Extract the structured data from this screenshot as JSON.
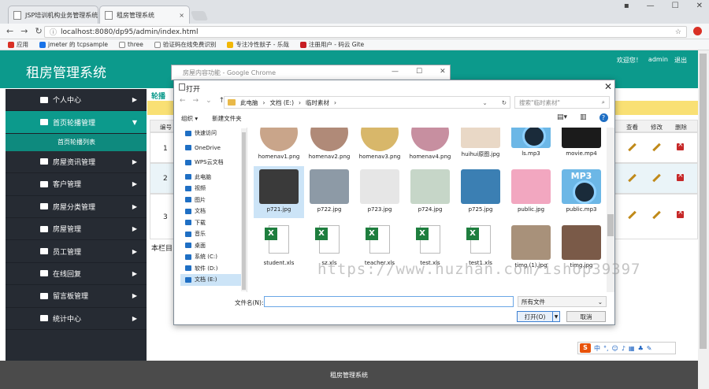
{
  "browser": {
    "tabs": [
      {
        "label": "JSP培训机构业务管理系统"
      },
      {
        "label": "租房管理系统"
      }
    ],
    "url": "localhost:8080/dp95/admin/index.html",
    "bookmarks": [
      {
        "label": "应用",
        "color": "#d93025"
      },
      {
        "label": "jmeter 的 tcpsample",
        "color": "#1a73e8"
      },
      {
        "label": "three",
        "color": "#555555"
      },
      {
        "label": "验证码在线免费识别",
        "color": "#5f6368"
      },
      {
        "label": "专注冷性獃子 - 乐哉",
        "color": "#f2b705"
      },
      {
        "label": "注册用户 - 码云 Gite",
        "color": "#c71d23"
      }
    ]
  },
  "app": {
    "title": "租房管理系统",
    "welcome": "欢迎您！",
    "user": "admin",
    "logout": "退出",
    "footer": "租房管理系统",
    "sidebar": [
      {
        "label": "个人中心",
        "arrow": "▶"
      },
      {
        "label": "首页轮播管理",
        "arrow": "▼",
        "active": true
      },
      {
        "label": "房屋资讯管理",
        "arrow": "▶"
      },
      {
        "label": "客户管理",
        "arrow": "▶"
      },
      {
        "label": "房屋分类管理",
        "arrow": "▶"
      },
      {
        "label": "房屋管理",
        "arrow": "▶"
      },
      {
        "label": "员工管理",
        "arrow": "▶"
      },
      {
        "label": "在线回复",
        "arrow": "▶"
      },
      {
        "label": "留言板管理",
        "arrow": "▶"
      },
      {
        "label": "统计中心",
        "arrow": "▶"
      }
    ],
    "sub_item": "首页轮播列表",
    "table_tab": "轮播",
    "table_headers": {
      "num": "编号",
      "view": "查看",
      "edit": "修改",
      "del": "删除"
    },
    "rows": [
      "1",
      "2",
      "3"
    ],
    "note": "本栏目"
  },
  "behind_window": {
    "title": "房屋内容功能 - Google Chrome"
  },
  "dialog": {
    "title": "打开",
    "path": [
      "此电脑",
      "文档 (E:)",
      "临时素材"
    ],
    "search_placeholder": "搜索\"临时素材\"",
    "organize": "组织 ▾",
    "new_folder": "新建文件夹",
    "tree": [
      {
        "label": "快速访问"
      },
      {
        "label": "OneDrive"
      },
      {
        "label": "WPS云文档"
      },
      {
        "label": "此电脑"
      },
      {
        "label": "视频"
      },
      {
        "label": "图片"
      },
      {
        "label": "文档"
      },
      {
        "label": "下载"
      },
      {
        "label": "音乐"
      },
      {
        "label": "桌面"
      },
      {
        "label": "系统 (C:)"
      },
      {
        "label": "软件 (D:)"
      },
      {
        "label": "文档 (E:)",
        "selected": true
      }
    ],
    "files": [
      {
        "name": "homenav1.png",
        "kind": "round",
        "color": "#c9a58a"
      },
      {
        "name": "homenav2.png",
        "kind": "round",
        "color": "#b08a78"
      },
      {
        "name": "homenav3.png",
        "kind": "round",
        "color": "#d8b76a"
      },
      {
        "name": "homenav4.png",
        "kind": "round",
        "color": "#c78fa0"
      },
      {
        "name": "huihui原图.jpg",
        "kind": "img",
        "color": "#e9d8c6"
      },
      {
        "name": "ls.mp3",
        "kind": "mp3"
      },
      {
        "name": "movie.mp4",
        "kind": "img",
        "color": "#1b1b1b"
      },
      {
        "name": "p721.jpg",
        "kind": "img",
        "color": "#3a3a3a",
        "selected": true
      },
      {
        "name": "p722.jpg",
        "kind": "img",
        "color": "#8d9aa6"
      },
      {
        "name": "p723.jpg",
        "kind": "img",
        "color": "#e6e6e6"
      },
      {
        "name": "p724.jpg",
        "kind": "img",
        "color": "#c6d6c8"
      },
      {
        "name": "p725.jpg",
        "kind": "img",
        "color": "#3b7fb3"
      },
      {
        "name": "public.jpg",
        "kind": "img",
        "color": "#f2a7c0"
      },
      {
        "name": "public.mp3",
        "kind": "mp3"
      },
      {
        "name": "student.xls",
        "kind": "xls"
      },
      {
        "name": "sz.xls",
        "kind": "xls"
      },
      {
        "name": "teacher.xls",
        "kind": "xls"
      },
      {
        "name": "test.xls",
        "kind": "xls"
      },
      {
        "name": "test1.xls",
        "kind": "xls"
      },
      {
        "name": "timg (1).jpg",
        "kind": "img",
        "color": "#a8917a"
      },
      {
        "name": "timg.jpg",
        "kind": "img",
        "color": "#7a5a48"
      }
    ],
    "filename_label": "文件名(N):",
    "filetype": "所有文件",
    "open": "打开(O)",
    "cancel": "取消"
  },
  "watermark": "https://www.huzhan.com/ishop39397"
}
